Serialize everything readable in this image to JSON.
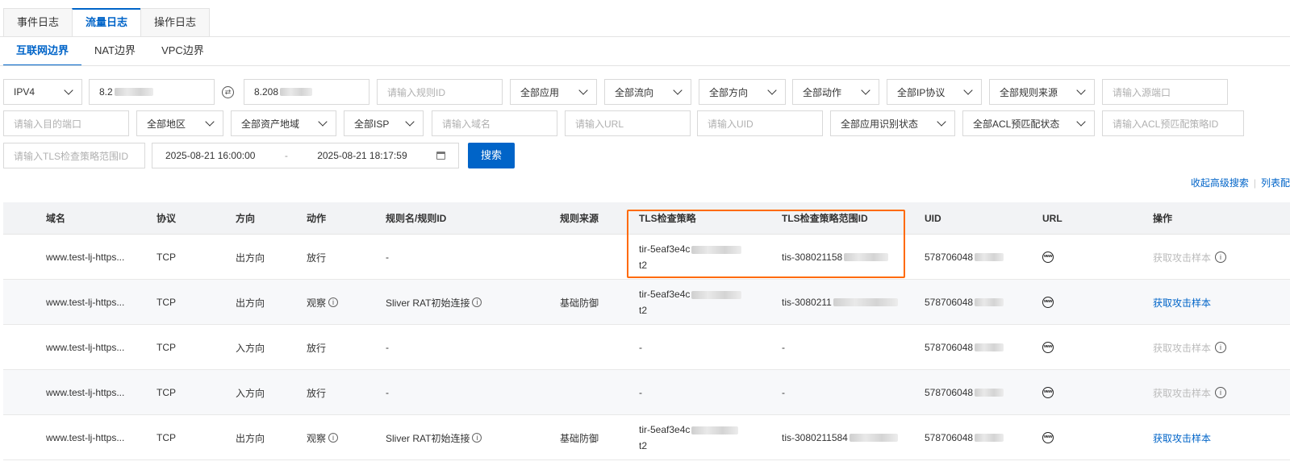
{
  "tabs": [
    "事件日志",
    "流量日志",
    "操作日志"
  ],
  "sub_tabs": [
    "互联网边界",
    "NAT边界",
    "VPC边界"
  ],
  "filters": {
    "ip_version": "IPV4",
    "src_ip": "8.2",
    "dst_ip": "8.208",
    "rule_id_ph": "请输入规则ID",
    "app": "全部应用",
    "flow": "全部流向",
    "direction": "全部方向",
    "action": "全部动作",
    "ip_protocol": "全部IP协议",
    "rule_source": "全部规则来源",
    "src_port_ph": "请输入源端口",
    "dst_port_ph": "请输入目的端口",
    "region": "全部地区",
    "asset_region": "全部资产地域",
    "isp": "全部ISP",
    "domain_ph": "请输入域名",
    "url_ph": "请输入URL",
    "uid_ph": "请输入UID",
    "app_status": "全部应用识别状态",
    "acl_status": "全部ACL预匹配状态",
    "acl_policy_ph": "请输入ACL预匹配策略ID",
    "tls_scope_ph": "请输入TLS检查策略范围ID",
    "start_time": "2025-08-21 16:00:00",
    "end_time": "2025-08-21 18:17:59",
    "range_sep": "-",
    "search_label": "搜索"
  },
  "adv": {
    "collapse": "收起高级搜索",
    "sep": "|",
    "columns": "列表配"
  },
  "table": {
    "columns": [
      "域名",
      "协议",
      "方向",
      "动作",
      "规则名/规则ID",
      "规则来源",
      "TLS检查策略",
      "TLS检查策略范围ID",
      "UID",
      "URL",
      "操作"
    ],
    "rows": [
      {
        "domain": "www.test-lj-https...",
        "protocol": "TCP",
        "direction": "出方向",
        "action": "放行",
        "action_info": false,
        "rule": "-",
        "rule_info": false,
        "source": "",
        "tls_l1": "tir-5eaf3e4c",
        "tls_l2": "t2",
        "scope": "tis-308021158",
        "uid": "578706048",
        "op": "获取攻击样本",
        "op_enabled": false
      },
      {
        "domain": "www.test-lj-https...",
        "protocol": "TCP",
        "direction": "出方向",
        "action": "观察",
        "action_info": true,
        "rule": "Sliver RAT初始连接",
        "rule_info": true,
        "source": "基础防御",
        "tls_l1": "tir-5eaf3e4c",
        "tls_l2": "t2",
        "scope": "tis-3080211",
        "uid": "578706048",
        "op": "获取攻击样本",
        "op_enabled": true
      },
      {
        "domain": "www.test-lj-https...",
        "protocol": "TCP",
        "direction": "入方向",
        "action": "放行",
        "action_info": false,
        "rule": "-",
        "rule_info": false,
        "source": "",
        "tls_l1": "-",
        "tls_l2": "",
        "scope": "-",
        "uid": "578706048",
        "op": "获取攻击样本",
        "op_enabled": false
      },
      {
        "domain": "www.test-lj-https...",
        "protocol": "TCP",
        "direction": "入方向",
        "action": "放行",
        "action_info": false,
        "rule": "-",
        "rule_info": false,
        "source": "",
        "tls_l1": "-",
        "tls_l2": "",
        "scope": "-",
        "uid": "578706048",
        "op": "获取攻击样本",
        "op_enabled": false
      },
      {
        "domain": "www.test-lj-https...",
        "protocol": "TCP",
        "direction": "出方向",
        "action": "观察",
        "action_info": true,
        "rule": "Sliver RAT初始连接",
        "rule_info": true,
        "source": "基础防御",
        "tls_l1": "tir-5eaf3e4c",
        "tls_l2": "t2",
        "scope": "tis-3080211584",
        "uid": "578706048",
        "op": "获取攻击样本",
        "op_enabled": true
      }
    ]
  },
  "colors": {
    "accent": "#0064c8",
    "highlight": "#ff6a00",
    "disabled": "#bbbbbb"
  }
}
